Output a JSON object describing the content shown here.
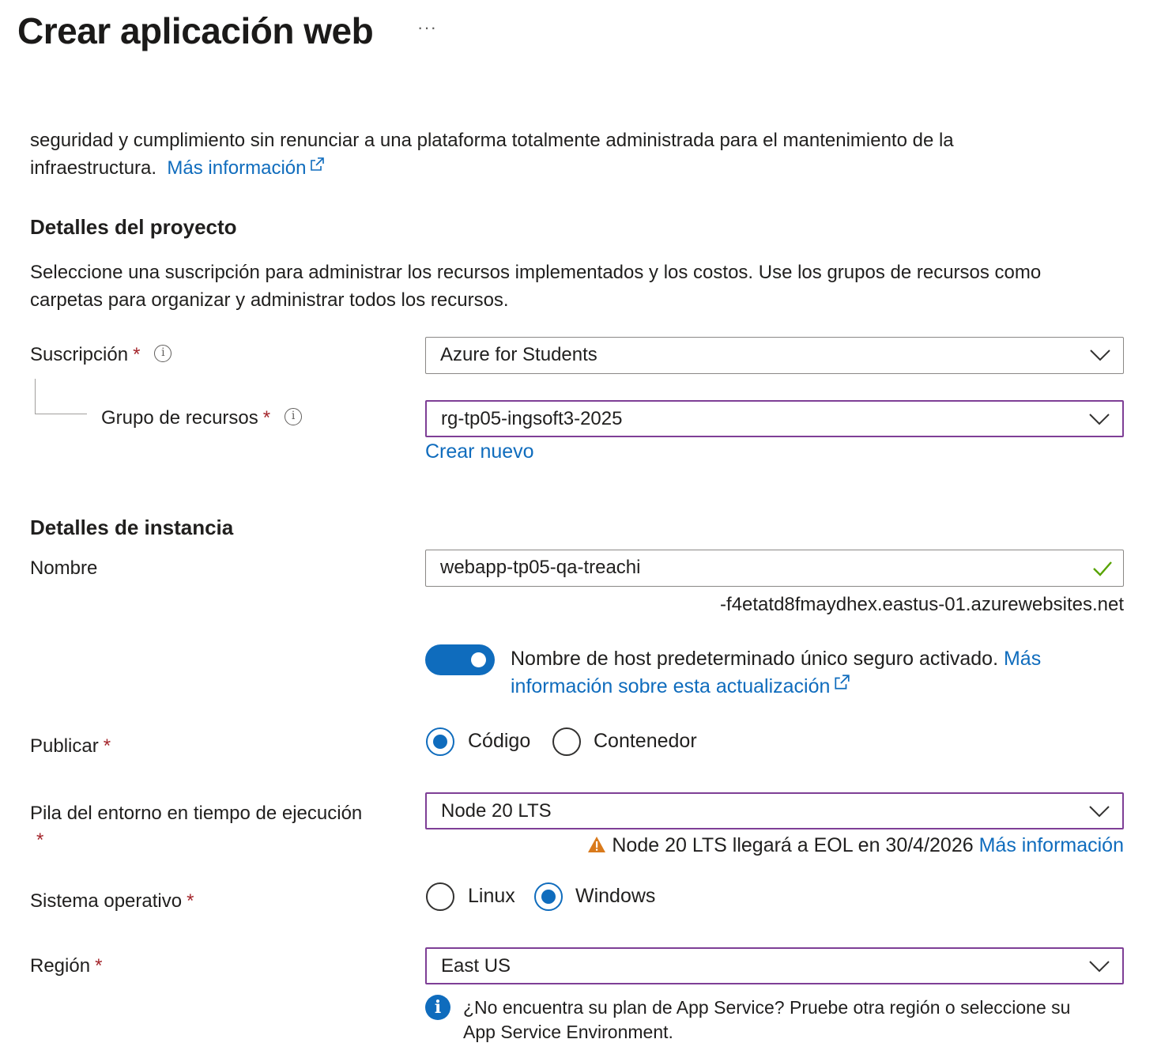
{
  "header": {
    "title": "Crear aplicación web",
    "more_label": "···"
  },
  "intro": {
    "text_line1": "seguridad y cumplimiento sin renunciar a una plataforma totalmente administrada para el mantenimiento de la",
    "text_line2": "infraestructura.",
    "link": "Más información"
  },
  "project": {
    "heading": "Detalles del proyecto",
    "description_line1": "Seleccione una suscripción para administrar los recursos implementados y los costos. Use los grupos de recursos como",
    "description_line2": "carpetas para organizar y administrar todos los recursos.",
    "subscription_label": "Suscripción",
    "subscription_value": "Azure for Students",
    "resource_group_label": "Grupo de recursos",
    "resource_group_value": "rg-tp05-ingsoft3-2025",
    "create_new_link": "Crear nuevo"
  },
  "instance": {
    "heading": "Detalles de instancia",
    "name_label": "Nombre",
    "name_value": "webapp-tp05-qa-treachi",
    "name_suffix": "-f4etatd8fmaydhex.eastus-01.azurewebsites.net",
    "toggle_text": "Nombre de host predeterminado único seguro activado.",
    "toggle_link_line1": "Más",
    "toggle_link_line2": "información sobre esta actualización",
    "publish_label": "Publicar",
    "publish_options": [
      "Código",
      "Contenedor"
    ],
    "publish_selected": "Código",
    "stack_label_line1": "Pila del entorno en tiempo de ejecución",
    "stack_value": "Node 20 LTS",
    "stack_warning": "Node 20 LTS llegará a EOL en 30/4/2026",
    "stack_warning_link": "Más información",
    "os_label": "Sistema operativo",
    "os_options": [
      "Linux",
      "Windows"
    ],
    "os_selected": "Windows",
    "region_label": "Región",
    "region_value": "East US",
    "region_info_line1": "¿No encuentra su plan de App Service? Pruebe otra región o seleccione su",
    "region_info_line2": "App Service Environment."
  },
  "required_marker": "*",
  "colors": {
    "accent": "#0f6cbd",
    "required": "#a4262c",
    "focus_border": "#7e3f96",
    "success": "#57a300",
    "warning": "#d97a1c"
  }
}
